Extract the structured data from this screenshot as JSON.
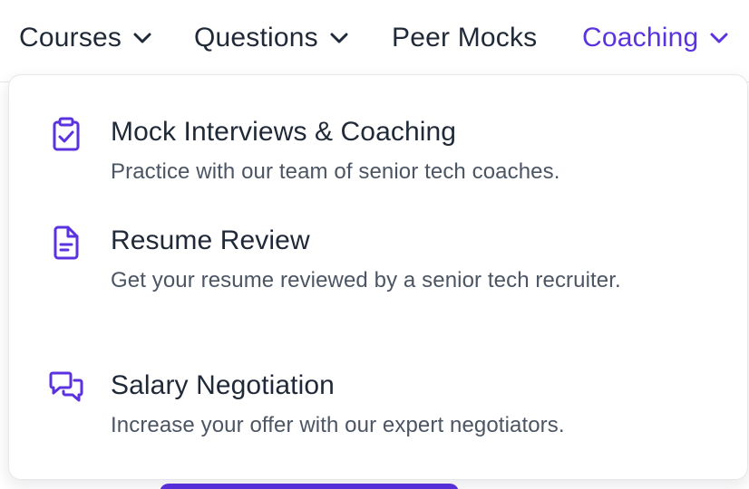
{
  "nav": {
    "items": [
      {
        "label": "Courses"
      },
      {
        "label": "Questions"
      },
      {
        "label": "Peer Mocks"
      },
      {
        "label": "Coaching"
      }
    ]
  },
  "dropdown": {
    "items": [
      {
        "title": "Mock Interviews & Coaching",
        "description": "Practice with our team of senior tech coaches.",
        "icon": "clipboard-check-icon"
      },
      {
        "title": "Resume Review",
        "description": "Get your resume reviewed by a senior tech recruiter.",
        "icon": "document-icon"
      },
      {
        "title": "Salary Negotiation",
        "description": "Increase your offer with our expert negotiators.",
        "icon": "chat-bubbles-icon"
      }
    ]
  },
  "colors": {
    "accent": "#5b32e0",
    "text": "#1f2937",
    "muted": "#4b5563"
  }
}
